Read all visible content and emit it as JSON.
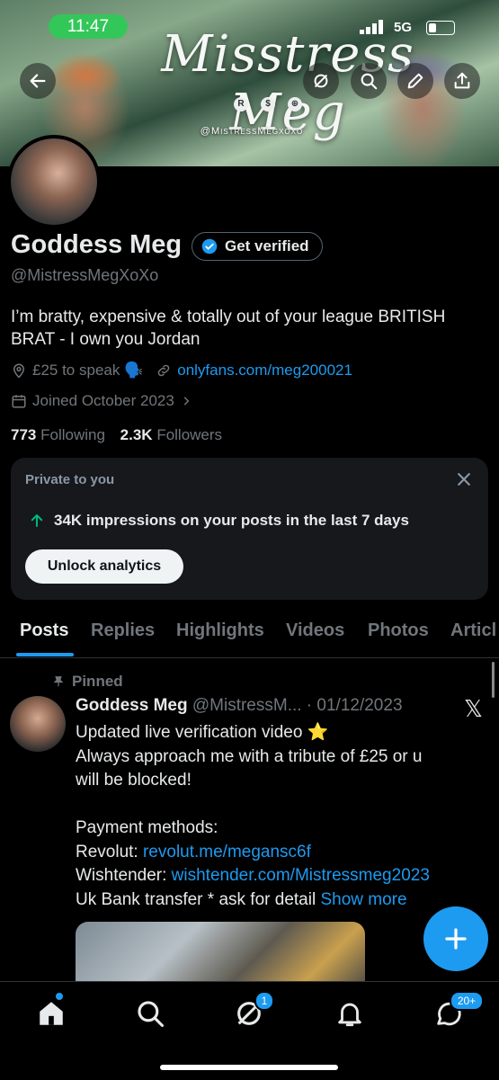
{
  "status_bar": {
    "time": "11:47",
    "network": "5G"
  },
  "banner": {
    "title": "Misstress Meg",
    "handle": "@MistressMegxoxo",
    "badges": [
      "R",
      "$",
      "⊕"
    ]
  },
  "header_actions": [
    "back-arrow-icon",
    "mute-icon",
    "search-icon",
    "edit-pen-icon",
    "share-icon"
  ],
  "profile": {
    "name": "Goddess Meg",
    "verify_label": "Get verified",
    "handle": "@MistressMegXoXo",
    "bio": "I’m bratty, expensive & totally out of your league BRITISH BRAT - I own you Jordan",
    "location": "£25 to speak 🗣️",
    "website": "onlyfans.com/meg200021",
    "joined": "Joined October 2023",
    "following_count": "773",
    "following_label": "Following",
    "followers_count": "2.3K",
    "followers_label": "Followers"
  },
  "analytics_card": {
    "title": "Private to you",
    "impressions": "34K impressions on your posts in the last 7 days",
    "button": "Unlock analytics"
  },
  "tabs": [
    "Posts",
    "Replies",
    "Highlights",
    "Videos",
    "Photos",
    "Articl"
  ],
  "active_tab": "Posts",
  "pinned_post": {
    "pinned_label": "Pinned",
    "author": "Goddess Meg",
    "handle_date": "@MistressM... · 01/12/2023",
    "lines": [
      "Updated live verification video ⭐",
      "Always approach me with a tribute of £25 or u",
      "will be blocked!",
      "",
      "Payment methods:"
    ],
    "revolut_label": "Revolut: ",
    "revolut_link": "revolut.me/megansc6f",
    "wishtender_label": "Wishtender: ",
    "wishtender_link": "wishtender.com/Mistressmeg2023",
    "bank_text": "Uk Bank transfer * ask for detail ",
    "show_more": "Show more"
  },
  "bottom_nav": {
    "items": [
      "home-icon",
      "search-icon",
      "grok-icon",
      "notifications-icon",
      "messages-icon"
    ],
    "grok_badge": "1",
    "messages_badge": "20+"
  },
  "colors": {
    "accent": "#1d9bf0",
    "background": "#000000",
    "muted": "#71767b",
    "status_green": "#33c759"
  }
}
